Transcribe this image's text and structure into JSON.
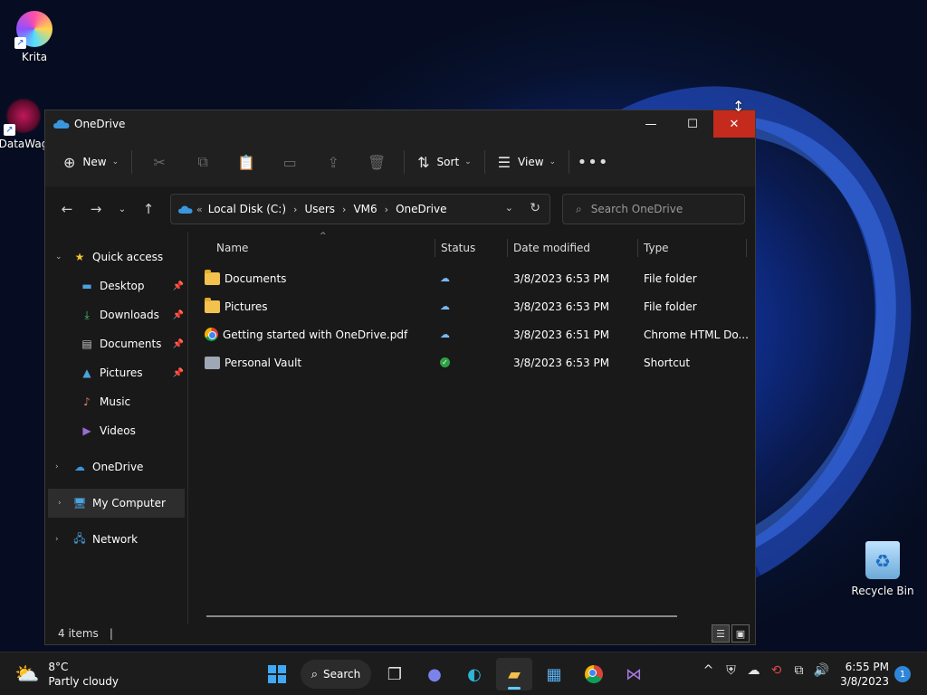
{
  "desktop": {
    "icons": [
      {
        "label": "Krita"
      },
      {
        "label": "DataWag"
      },
      {
        "label": "Recycle Bin"
      }
    ]
  },
  "window": {
    "title": "OneDrive",
    "controls": {
      "minimize": "—",
      "maximize": "☐",
      "close": "✕"
    }
  },
  "commandbar": {
    "new_label": "New",
    "sort_label": "Sort",
    "view_label": "View",
    "more_label": "•••"
  },
  "address": {
    "crumbs": [
      "Local Disk (C:)",
      "Users",
      "VM6",
      "OneDrive"
    ],
    "overflow": "«"
  },
  "search": {
    "placeholder": "Search OneDrive"
  },
  "sidebar": {
    "quick_access": "Quick access",
    "items": [
      {
        "label": "Desktop",
        "pinned": true
      },
      {
        "label": "Downloads",
        "pinned": true
      },
      {
        "label": "Documents",
        "pinned": true
      },
      {
        "label": "Pictures",
        "pinned": true
      },
      {
        "label": "Music",
        "pinned": false
      },
      {
        "label": "Videos",
        "pinned": false
      }
    ],
    "onedrive": "OneDrive",
    "my_computer": "My Computer",
    "network": "Network"
  },
  "columns": {
    "name": "Name",
    "status": "Status",
    "date": "Date modified",
    "type": "Type"
  },
  "files": [
    {
      "name": "Documents",
      "date": "3/8/2023 6:53 PM",
      "type": "File folder",
      "status": "cloud"
    },
    {
      "name": "Pictures",
      "date": "3/8/2023 6:53 PM",
      "type": "File folder",
      "status": "cloud"
    },
    {
      "name": "Getting started with OneDrive.pdf",
      "date": "3/8/2023 6:51 PM",
      "type": "Chrome HTML Do...",
      "status": "cloud"
    },
    {
      "name": "Personal Vault",
      "date": "3/8/2023 6:53 PM",
      "type": "Shortcut",
      "status": "ok"
    }
  ],
  "statusbar": {
    "count": "4 items",
    "caret": "|"
  },
  "taskbar": {
    "weather_temp": "8°C",
    "weather_desc": "Partly cloudy",
    "search_label": "Search",
    "time": "6:55 PM",
    "date": "3/8/2023",
    "notifications": "1"
  }
}
